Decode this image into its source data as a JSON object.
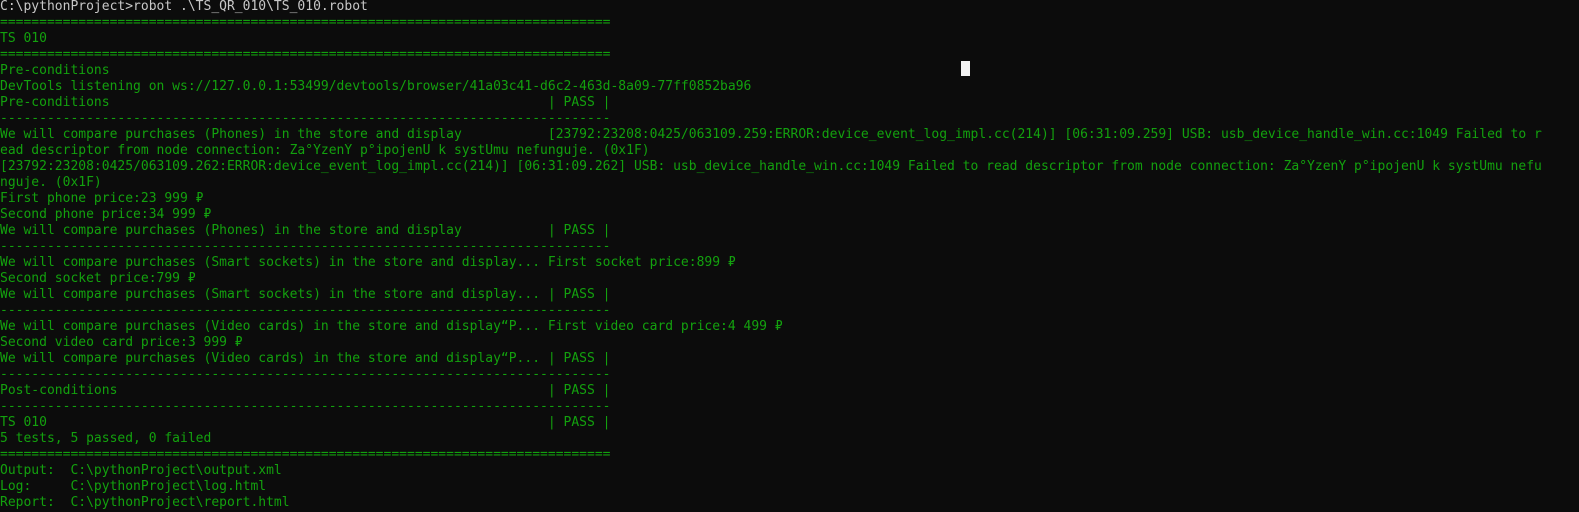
{
  "terminal": {
    "lines": [
      "C:\\pythonProject>robot .\\TS_QR_010\\TS_010.robot",
      "==============================================================================",
      "TS 010",
      "==============================================================================",
      "Pre-conditions",
      "DevTools listening on ws://127.0.0.1:53499/devtools/browser/41a03c41-d6c2-463d-8a09-77ff0852ba96",
      "Pre-conditions                                                        | PASS |",
      "------------------------------------------------------------------------------",
      "We will compare purchases (Phones) in the store and display           [23792:23208:0425/063109.259:ERROR:device_event_log_impl.cc(214)] [06:31:09.259] USB: usb_device_handle_win.cc:1049 Failed to r",
      "ead descriptor from node connection: Za°ÝzenÝ p°ipojenÚ k systÚmu nefunguje. (0x1F)",
      "[23792:23208:0425/063109.262:ERROR:device_event_log_impl.cc(214)] [06:31:09.262] USB: usb_device_handle_win.cc:1049 Failed to read descriptor from node connection: Za°ÝzenÝ p°ipojenÚ k systÚmu nefu",
      "nguje. (0x1F)",
      "First phone price:23 999 ₽",
      "Second phone price:34 999 ₽",
      "We will compare purchases (Phones) in the store and display           | PASS |",
      "------------------------------------------------------------------------------",
      "We will compare purchases (Smart sockets) in the store and display... First socket price:899 ₽",
      "Second socket price:799 ₽",
      "We will compare purchases (Smart sockets) in the store and display... | PASS |",
      "------------------------------------------------------------------------------",
      "We will compare purchases (Video cards) in the store and display“P... First video card price:4 499 ₽",
      "Second video card price:3 999 ₽",
      "We will compare purchases (Video cards) in the store and display“P... | PASS |",
      "------------------------------------------------------------------------------",
      "Post-conditions                                                       | PASS |",
      "------------------------------------------------------------------------------",
      "TS 010                                                                | PASS |",
      "5 tests, 5 passed, 0 failed",
      "==============================================================================",
      "Output:  C:\\pythonProject\\output.xml",
      "Log:     C:\\pythonProject\\log.html",
      "Report:  C:\\pythonProject\\report.html"
    ]
  },
  "colors": {
    "background": "#0c0c0c",
    "text": "#13a10e",
    "command_text": "#c8c8c8",
    "cursor": "#f2f2f2"
  }
}
